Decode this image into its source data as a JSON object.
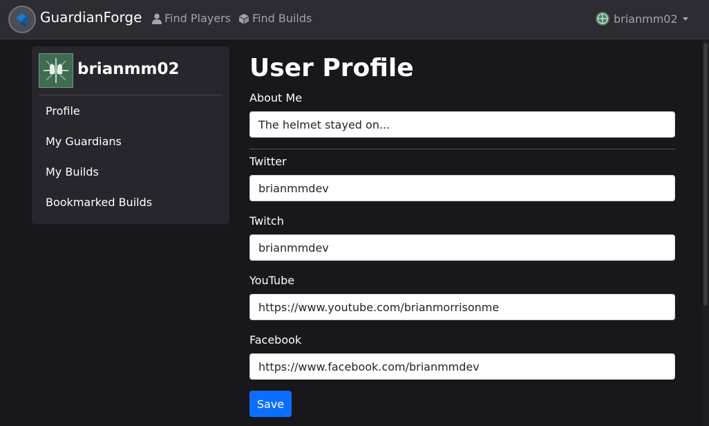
{
  "brand": {
    "name": "GuardianForge",
    "logo_icon": "hammer-shield-icon"
  },
  "nav": {
    "find_players": "Find Players",
    "find_builds": "Find Builds",
    "user_menu_label": "brianmm02"
  },
  "sidebar": {
    "username": "brianmm02",
    "items": [
      {
        "label": "Profile"
      },
      {
        "label": "My Guardians"
      },
      {
        "label": "My Builds"
      },
      {
        "label": "Bookmarked Builds"
      }
    ]
  },
  "form": {
    "title": "User Profile",
    "about_me": {
      "label": "About Me",
      "value": "The helmet stayed on..."
    },
    "twitter": {
      "label": "Twitter",
      "value": "brianmmdev"
    },
    "twitch": {
      "label": "Twitch",
      "value": "brianmmdev"
    },
    "youtube": {
      "label": "YouTube",
      "value": "https://www.youtube.com/brianmorrisonme"
    },
    "facebook": {
      "label": "Facebook",
      "value": "https://www.facebook.com/brianmmdev"
    },
    "save_label": "Save"
  },
  "colors": {
    "navbar_bg": "#2c2c32",
    "page_bg": "#17171c",
    "sidebar_bg": "#26262c",
    "primary_button": "#0d6efd",
    "avatar_green": "#3f6b52"
  }
}
